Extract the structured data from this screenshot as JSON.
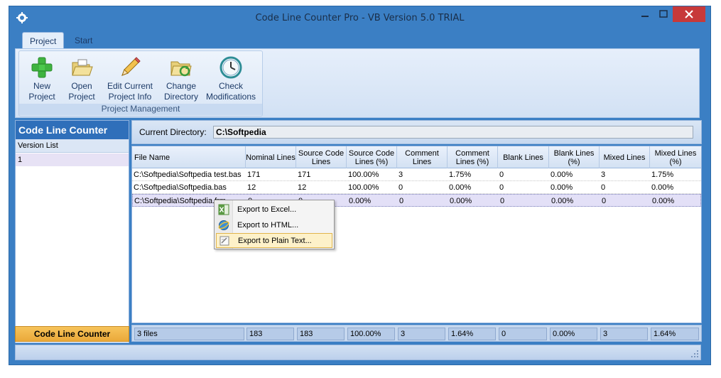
{
  "window": {
    "title": "Code Line Counter Pro - VB Version 5.0 TRIAL"
  },
  "ribbon": {
    "tabs": [
      {
        "label": "Project",
        "active": true
      },
      {
        "label": "Start",
        "active": false
      }
    ],
    "group_label": "Project Management",
    "buttons": [
      {
        "label": "New\nProject",
        "icon": "green-plus-icon"
      },
      {
        "label": "Open\nProject",
        "icon": "open-folder-icon"
      },
      {
        "label": "Edit Current\nProject Info",
        "icon": "pencil-icon"
      },
      {
        "label": "Change\nDirectory",
        "icon": "folder-refresh-icon"
      },
      {
        "label": "Check\nModifications",
        "icon": "clock-icon"
      }
    ]
  },
  "left_panel": {
    "title": "Code Line Counter",
    "subheader": "Version List",
    "items": [
      "1"
    ],
    "footer": "Code Line Counter"
  },
  "current_directory": {
    "label": "Current Directory:",
    "value": "C:\\Softpedia"
  },
  "grid": {
    "columns": [
      "File Name",
      "Nominal Lines",
      "Source Code\nLines",
      "Source Code\nLines (%)",
      "Comment\nLines",
      "Comment\nLines (%)",
      "Blank Lines",
      "Blank Lines\n(%)",
      "Mixed Lines",
      "Mixed Lines\n(%)"
    ],
    "rows": [
      [
        "C:\\Softpedia\\Softpedia test.bas",
        "171",
        "171",
        "100.00%",
        "3",
        "1.75%",
        "0",
        "0.00%",
        "3",
        "1.75%"
      ],
      [
        "C:\\Softpedia\\Softpedia.bas",
        "12",
        "12",
        "100.00%",
        "0",
        "0.00%",
        "0",
        "0.00%",
        "0",
        "0.00%"
      ],
      [
        "C:\\Softpedia\\Softpedia.frm",
        "0",
        "0",
        "0.00%",
        "0",
        "0.00%",
        "0",
        "0.00%",
        "0",
        "0.00%"
      ]
    ],
    "selected_row": 2,
    "totals": [
      "3 files",
      "183",
      "183",
      "100.00%",
      "3",
      "1.64%",
      "0",
      "0.00%",
      "3",
      "1.64%"
    ]
  },
  "context_menu": {
    "items": [
      {
        "label": "Export to Excel...",
        "icon": "excel-icon"
      },
      {
        "label": "Export to HTML...",
        "icon": "html-icon"
      },
      {
        "label": "Export to Plain Text...",
        "icon": "text-file-icon"
      }
    ],
    "highlighted": 2
  },
  "colors": {
    "frame": "#3b7fc4",
    "header_blue": "#2f6fba",
    "footer_orange": "#f0b447",
    "close_red": "#c7393a"
  }
}
